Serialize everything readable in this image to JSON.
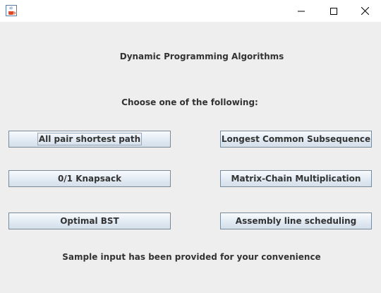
{
  "titlebar": {
    "app_icon": "java-cup-icon",
    "controls": [
      "minimize-icon",
      "maximize-icon",
      "close-icon"
    ]
  },
  "main": {
    "heading": "Dynamic Programming Algorithms",
    "prompt": "Choose one of the following:",
    "buttons": [
      {
        "label": "All pair shortest path"
      },
      {
        "label": "Longest Common Subsequence"
      },
      {
        "label": "0/1 Knapsack"
      },
      {
        "label": "Matrix-Chain Multiplication"
      },
      {
        "label": "Optimal BST"
      },
      {
        "label": "Assembly line scheduling"
      }
    ],
    "footer_note": "Sample input has been provided for your convenience"
  }
}
